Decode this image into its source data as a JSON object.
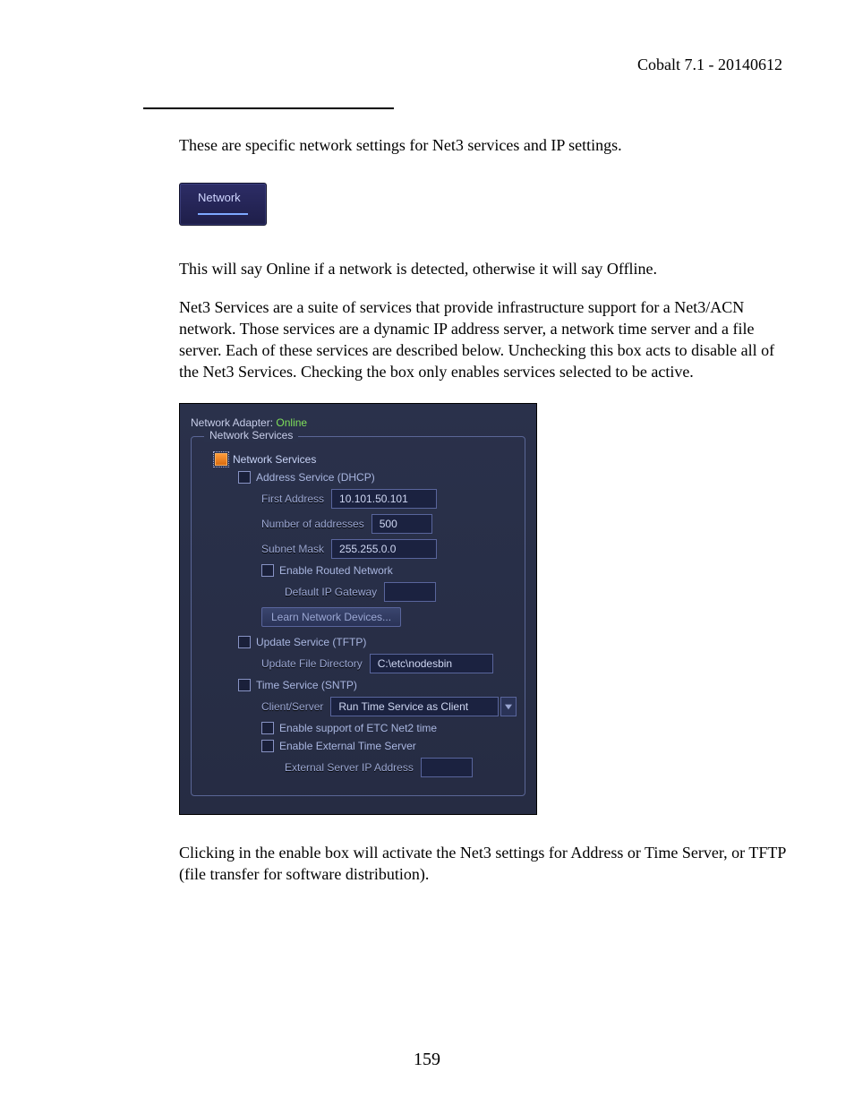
{
  "header": {
    "right": "Cobalt 7.1 - 20140612"
  },
  "paras": {
    "p1": "These are specific network settings for Net3 services and IP settings.",
    "p2": "This will say Online if a network is detected, otherwise it will say Offline.",
    "p3": "Net3 Services are a suite of services that provide infrastructure support for a Net3/ACN network. Those services are a dynamic IP address server, a network time server and a file server. Each of these services are described below. Unchecking this box acts to disable all of the Net3 Services. Checking the box only enables services selected to be active.",
    "p4": "Clicking in the enable box will activate the Net3 settings for Address or Time Server, or TFTP (file transfer for software distribution)."
  },
  "network_button": {
    "label": "Network"
  },
  "panel": {
    "adapter_label": "Network Adapter:",
    "adapter_status": "Online",
    "fieldset_legend": "Network Services",
    "network_services": {
      "label": "Network Services",
      "checked": true
    },
    "dhcp": {
      "label": "Address Service (DHCP)",
      "checked": false,
      "first_address": {
        "label": "First Address",
        "value": "10.101.50.101"
      },
      "num_addresses": {
        "label": "Number of addresses",
        "value": "500"
      },
      "subnet_mask": {
        "label": "Subnet Mask",
        "value": "255.255.0.0"
      },
      "routed": {
        "label": "Enable Routed Network",
        "checked": false
      },
      "gateway": {
        "label": "Default IP Gateway",
        "value": ""
      },
      "learn_btn": "Learn Network Devices..."
    },
    "tftp": {
      "label": "Update Service (TFTP)",
      "checked": false,
      "dir": {
        "label": "Update File Directory",
        "value": "C:\\etc\\nodesbin"
      }
    },
    "sntp": {
      "label": "Time Service (SNTP)",
      "checked": false,
      "mode": {
        "label": "Client/Server",
        "value": "Run Time Service as Client"
      },
      "net2": {
        "label": "Enable support of ETC Net2 time",
        "checked": false
      },
      "ext": {
        "label": "Enable External Time Server",
        "checked": false
      },
      "ext_ip": {
        "label": "External Server IP Address",
        "value": ""
      }
    }
  },
  "page_number": "159"
}
